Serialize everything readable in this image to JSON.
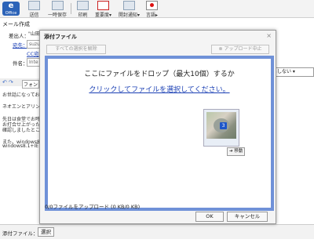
{
  "toolbar": {
    "logo_text": "Office",
    "buttons": [
      {
        "label": "送信",
        "icon": "send-icon"
      },
      {
        "label": "一時保存",
        "icon": "save-draft-icon"
      },
      {
        "label": "印刷",
        "icon": "print-icon"
      },
      {
        "label": "重要度▾",
        "icon": "importance-icon"
      },
      {
        "label": "開封通知▾",
        "icon": "read-receipt-icon"
      },
      {
        "label": "言語▸",
        "icon": "language-flag-icon"
      }
    ]
  },
  "compose": {
    "title": "メール作成",
    "from_label": "差出人：",
    "from_value": "\"山田",
    "to_label": "宛先：",
    "to_value": "suzu",
    "cc_label": "CC宛",
    "subject_label": "件名：",
    "subject_value": "Inte",
    "font_label": "フォン",
    "reply_select": "要名しない ▾",
    "body_lines": [
      "お世話になってお",
      "ネオエンとアリン",
      "先日は食堂でお時",
      "お打合せ上がった",
      "確認しましたとこ",
      "また、windows8.",
      "windows8.1+IE"
    ]
  },
  "footer": {
    "attach_label": "添付ファイル：",
    "select_button": "選択"
  },
  "dialog": {
    "title": "添付ファイル",
    "close": "×",
    "clear_selection": "すべての選択を解除",
    "cancel_upload": "⊗ アップロード中止",
    "drop_text": "ここにファイルをドロップ（最大10個）するか",
    "drop_link": "クリックしてファイルを選択してください。",
    "thumb_badge": "3",
    "move_button": "➔ 移動",
    "upload_status": "0/0ファイルをアップロード (0 KB/0 KB)",
    "ok": "OK",
    "cancel": "キャンセル"
  },
  "colors": {
    "drop_border": "#6f91d8",
    "link": "#1a3fb4"
  }
}
